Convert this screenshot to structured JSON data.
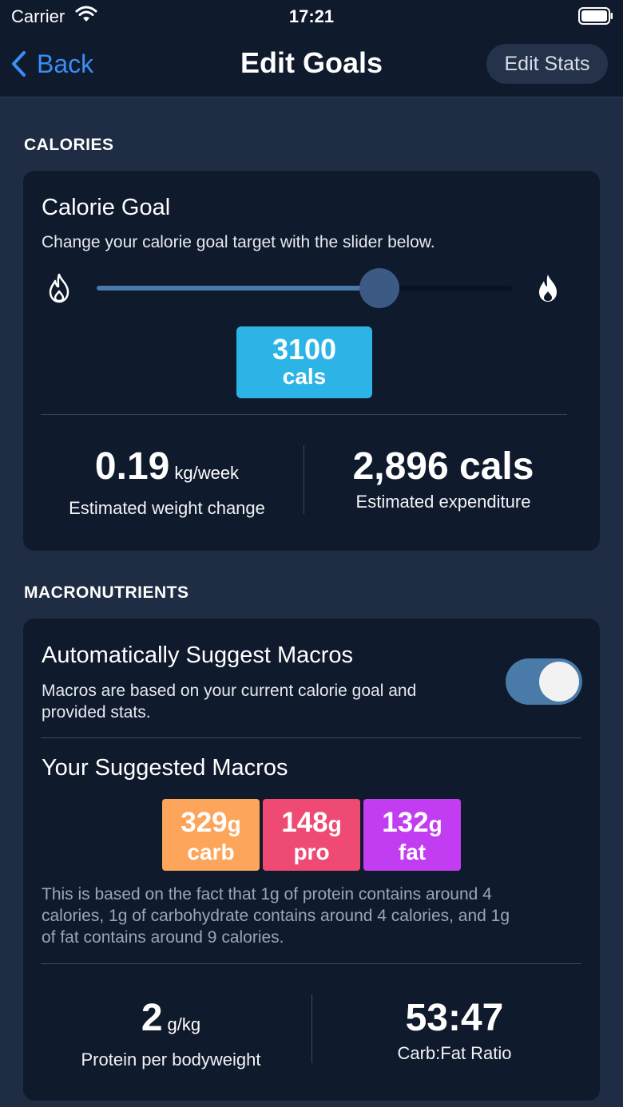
{
  "status_bar": {
    "carrier": "Carrier",
    "time": "17:21"
  },
  "nav": {
    "back_label": "Back",
    "title": "Edit Goals",
    "edit_stats_label": "Edit Stats"
  },
  "calories": {
    "section_header": "CALORIES",
    "card_title": "Calorie Goal",
    "card_subtitle": "Change your calorie goal target with the slider below.",
    "slider_level": 0.68,
    "goal_value": "3100",
    "goal_unit": "cals",
    "weight_change_value": "0.19",
    "weight_change_unit": "kg/week",
    "weight_change_label": "Estimated weight change",
    "expenditure_value": "2,896 cals",
    "expenditure_label": "Estimated expenditure"
  },
  "macros": {
    "section_header": "MACRONUTRIENTS",
    "auto_title": "Automatically Suggest Macros",
    "auto_desc_line1": "Macros are based on your current calorie goal and",
    "auto_desc_line2": "provided stats.",
    "auto_enabled": true,
    "suggested_title": "Your Suggested Macros",
    "items": [
      {
        "value": "329",
        "unit": "g",
        "name": "carb",
        "color": "#fda55b"
      },
      {
        "value": "148",
        "unit": "g",
        "name": "pro",
        "color": "#ef4a73"
      },
      {
        "value": "132",
        "unit": "g",
        "name": "fat",
        "color": "#c23cf2"
      }
    ],
    "note_line1": "This is based on the fact that 1g of protein contains around 4",
    "note_line2": "calories, 1g of carbohydrate contains around 4 calories, and 1g",
    "note_line3": "of fat contains around 9 calories.",
    "protein_value": "2",
    "protein_unit": "g/kg",
    "protein_label": "Protein per bodyweight",
    "ratio_value": "53:47",
    "ratio_label": "Carb:Fat Ratio"
  },
  "colors": {
    "accent": "#3a8ef5",
    "badge": "#2db4e6",
    "toggle_on": "#4a7ba8"
  }
}
